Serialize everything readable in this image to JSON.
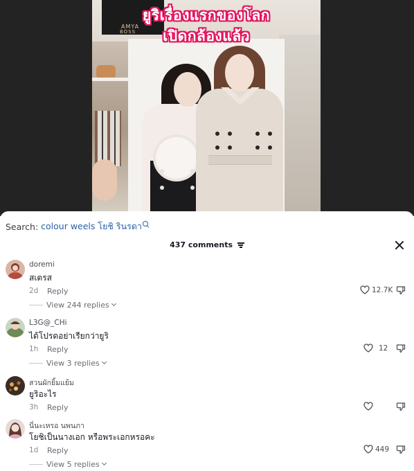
{
  "video": {
    "title_line1": "ยูริเรื่องแรกของโลก",
    "title_line2": "เปิดกล้องแล้ว",
    "sign_text_1": "AMYA",
    "sign_text_2": "BOSS",
    "title_outline_color": "#e2165e"
  },
  "search": {
    "label": "Search:",
    "query": "colour weels โยชิ รินรดา",
    "query_color": "#2b5fa8"
  },
  "comments_header": {
    "count_label": "437 comments"
  },
  "comments": [
    {
      "username": "doremi",
      "text": "สเตรส",
      "time": "2d",
      "reply_label": "Reply",
      "likes": "12.7K",
      "view_replies": "View 244 replies"
    },
    {
      "username": "L3G@_CHi",
      "text": "ได้โปรดอย่าเรียกว่ายูริ",
      "time": "1h",
      "reply_label": "Reply",
      "likes": "12",
      "view_replies": "View 3 replies"
    },
    {
      "username": "สวนผักยิ้มแย้ม",
      "text": "ยูริอะไร",
      "time": "3h",
      "reply_label": "Reply",
      "likes": ""
    },
    {
      "username": "นี่นะเหรอ นพนภา",
      "text": "โยชิเป็นนางเอก หรือพระเอกหรอคะ",
      "time": "1d",
      "reply_label": "Reply",
      "likes": "449",
      "view_replies": "View 5 replies"
    }
  ],
  "icons": {
    "close": "close-icon",
    "filter": "filter-icon",
    "like": "heart-icon",
    "dislike": "thumbs-down-icon",
    "search": "search-icon"
  }
}
